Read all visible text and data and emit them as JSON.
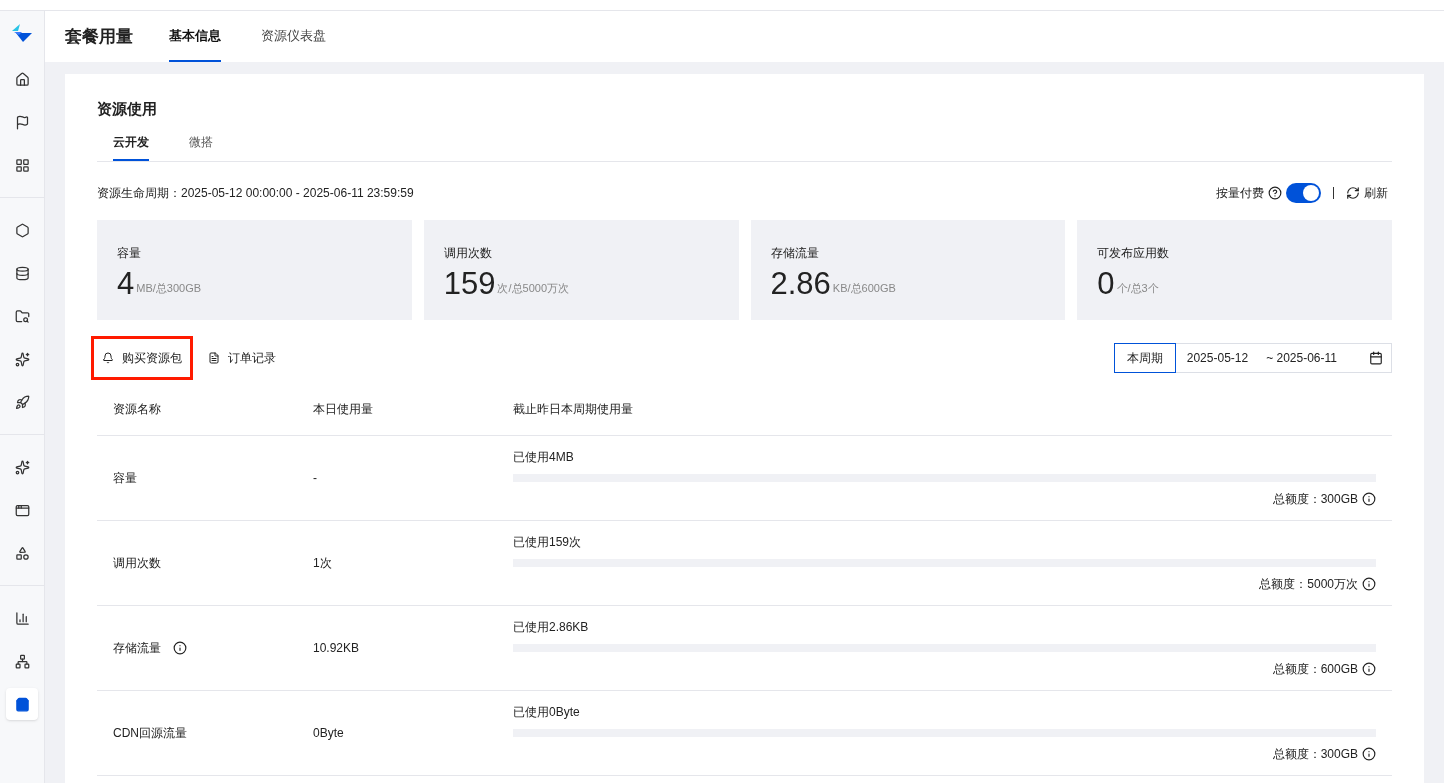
{
  "header": {
    "title": "套餐用量",
    "tabs": [
      {
        "label": "基本信息",
        "selected": true
      },
      {
        "label": "资源仪表盘",
        "selected": false
      }
    ]
  },
  "sidebar": {
    "groups": [
      {
        "items": [
          {
            "selected": false
          },
          {
            "selected": false
          },
          {
            "selected": false
          }
        ]
      },
      {
        "items": [
          {
            "selected": false
          },
          {
            "selected": false
          },
          {
            "selected": false
          },
          {
            "selected": false
          },
          {
            "selected": false
          }
        ]
      },
      {
        "items": [
          {
            "selected": false
          },
          {
            "selected": false
          },
          {
            "selected": false
          }
        ]
      },
      {
        "items": [
          {
            "selected": false
          },
          {
            "selected": false
          },
          {
            "selected": true
          }
        ]
      }
    ]
  },
  "section": {
    "title": "资源使用",
    "tabs": [
      {
        "label": "云开发",
        "selected": true
      },
      {
        "label": "微搭",
        "selected": false
      }
    ]
  },
  "lifecycle": "资源生命周期：2025-05-12 00:00:00 - 2025-06-11 23:59:59",
  "billing": {
    "label": "按量付费",
    "on": true,
    "refresh": "刷新"
  },
  "stats": [
    {
      "label": "容量",
      "value": "4",
      "unit": "MB/总300GB"
    },
    {
      "label": "调用次数",
      "value": "159",
      "unit": "次/总5000万次"
    },
    {
      "label": "存储流量",
      "value": "2.86",
      "unit": "KB/总600GB"
    },
    {
      "label": "可发布应用数",
      "value": "0",
      "unit": "个/总3个"
    }
  ],
  "actions": [
    {
      "label": "购买资源包",
      "highlighted": true
    },
    {
      "label": "订单记录",
      "highlighted": false
    }
  ],
  "period": {
    "preset": "本周期",
    "start": "2025-05-12",
    "end": "~ 2025-06-11"
  },
  "table": {
    "columns": [
      "资源名称",
      "本日使用量",
      "截止昨日本周期使用量"
    ],
    "rows": [
      {
        "name": "容量",
        "info": false,
        "today": "-",
        "used": "已使用4MB",
        "level": 0,
        "quota": "总额度：300GB"
      },
      {
        "name": "调用次数",
        "info": false,
        "today": "1次",
        "used": "已使用159次",
        "level": 0,
        "quota": "总额度：5000万次"
      },
      {
        "name": "存储流量",
        "info": true,
        "today": "10.92KB",
        "used": "已使用2.86KB",
        "level": 0,
        "quota": "总额度：600GB"
      },
      {
        "name": "CDN回源流量",
        "info": false,
        "today": "0Byte",
        "used": "已使用0Byte",
        "level": 0,
        "quota": "总额度：300GB"
      }
    ]
  }
}
